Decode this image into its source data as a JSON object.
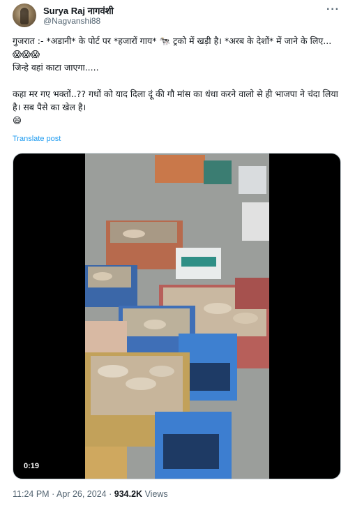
{
  "author": {
    "display_name": "Surya Raj नागवंशी",
    "handle": "@Nagvanshi88"
  },
  "menu_icon": "more-horizontal-icon",
  "post": {
    "text": "गुजरात :- *अडानी* के पोर्ट पर *हजारों गाय* 🐄 ट्रको में खड़ी है। *अरब के देशों* में जाने के लिए... 😱😱😱\nजिन्हे वहां काटा जाएगा.....\n\nकहा मर गए भक्तों..?? गधों को याद दिला दूं की गौ मांस का धंधा करने वालो से ही भाजपा ने चंदा लिया है। सब पैसे का खेल है।\n😄",
    "translate_label": "Translate post"
  },
  "media": {
    "duration": "0:19"
  },
  "footer": {
    "time": "11:24 PM",
    "separator": "·",
    "date": "Apr 26, 2024",
    "views_count": "934.2K",
    "views_label": "Views"
  }
}
